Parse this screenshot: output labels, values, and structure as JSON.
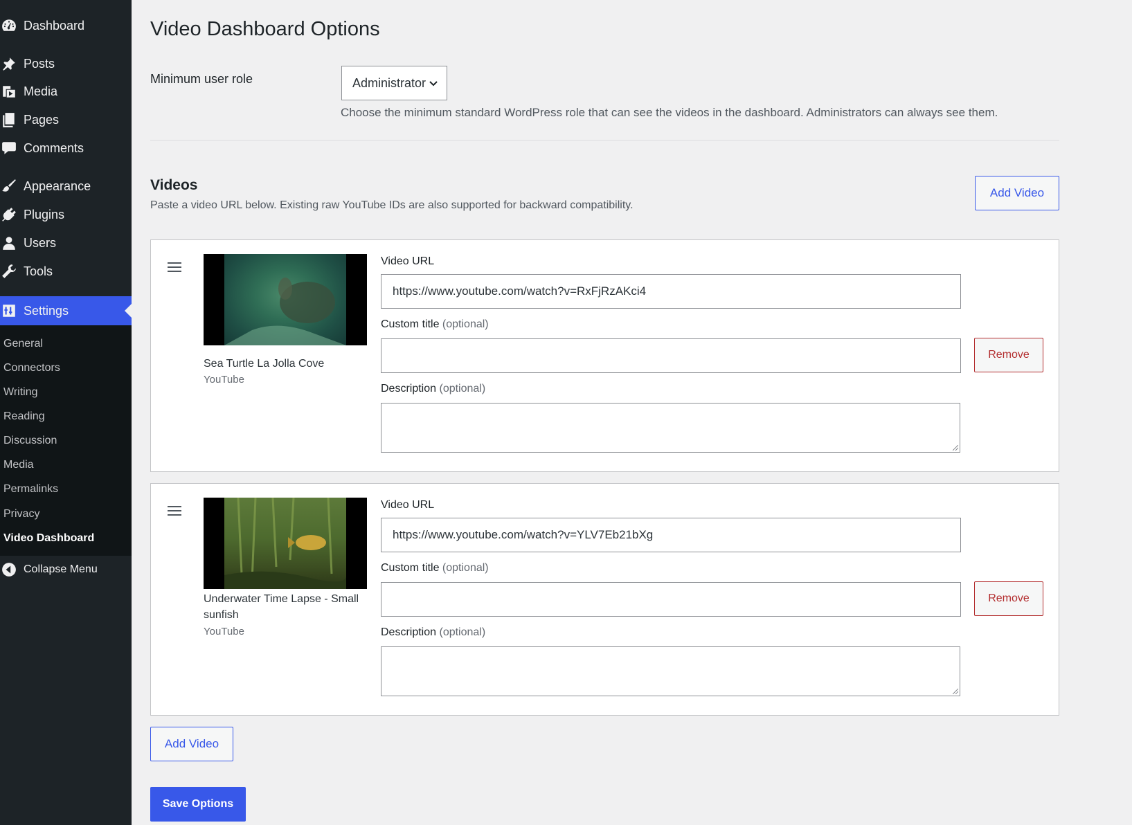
{
  "sidebar": {
    "items": [
      {
        "label": "Dashboard",
        "icon": "dashboard-icon"
      },
      {
        "label": "Posts",
        "icon": "pin-icon"
      },
      {
        "label": "Media",
        "icon": "media-icon"
      },
      {
        "label": "Pages",
        "icon": "pages-icon"
      },
      {
        "label": "Comments",
        "icon": "comment-icon"
      },
      {
        "label": "Appearance",
        "icon": "brush-icon"
      },
      {
        "label": "Plugins",
        "icon": "plugin-icon"
      },
      {
        "label": "Users",
        "icon": "user-icon"
      },
      {
        "label": "Tools",
        "icon": "wrench-icon"
      },
      {
        "label": "Settings",
        "icon": "settings-icon"
      }
    ],
    "submenu": [
      "General",
      "Connectors",
      "Writing",
      "Reading",
      "Discussion",
      "Media",
      "Permalinks",
      "Privacy",
      "Video Dashboard"
    ],
    "collapse_label": "Collapse Menu"
  },
  "page": {
    "title": "Video Dashboard Options",
    "role_label": "Minimum user role",
    "role_value": "Administrator",
    "role_help": "Choose the minimum standard WordPress role that can see the videos in the dashboard. Administrators can always see them.",
    "videos_title": "Videos",
    "videos_desc": "Paste a video URL below. Existing raw YouTube IDs are also supported for backward compatibility.",
    "add_video_label": "Add Video",
    "save_label": "Save Options"
  },
  "labels": {
    "video_url": "Video URL",
    "custom_title": "Custom title",
    "description": "Description",
    "optional": "(optional)",
    "remove": "Remove"
  },
  "videos": [
    {
      "title": "Sea Turtle La Jolla Cove",
      "source": "YouTube",
      "url": "https://www.youtube.com/watch?v=RxFjRzAKci4",
      "custom_title": "",
      "description": ""
    },
    {
      "title": "Underwater Time Lapse - Small sunfish",
      "source": "YouTube",
      "url": "https://www.youtube.com/watch?v=YLV7Eb21bXg",
      "custom_title": "",
      "description": ""
    }
  ],
  "colors": {
    "accent": "#3858e9",
    "sidebar_bg": "#1d2327",
    "remove": "#b32d2e"
  }
}
